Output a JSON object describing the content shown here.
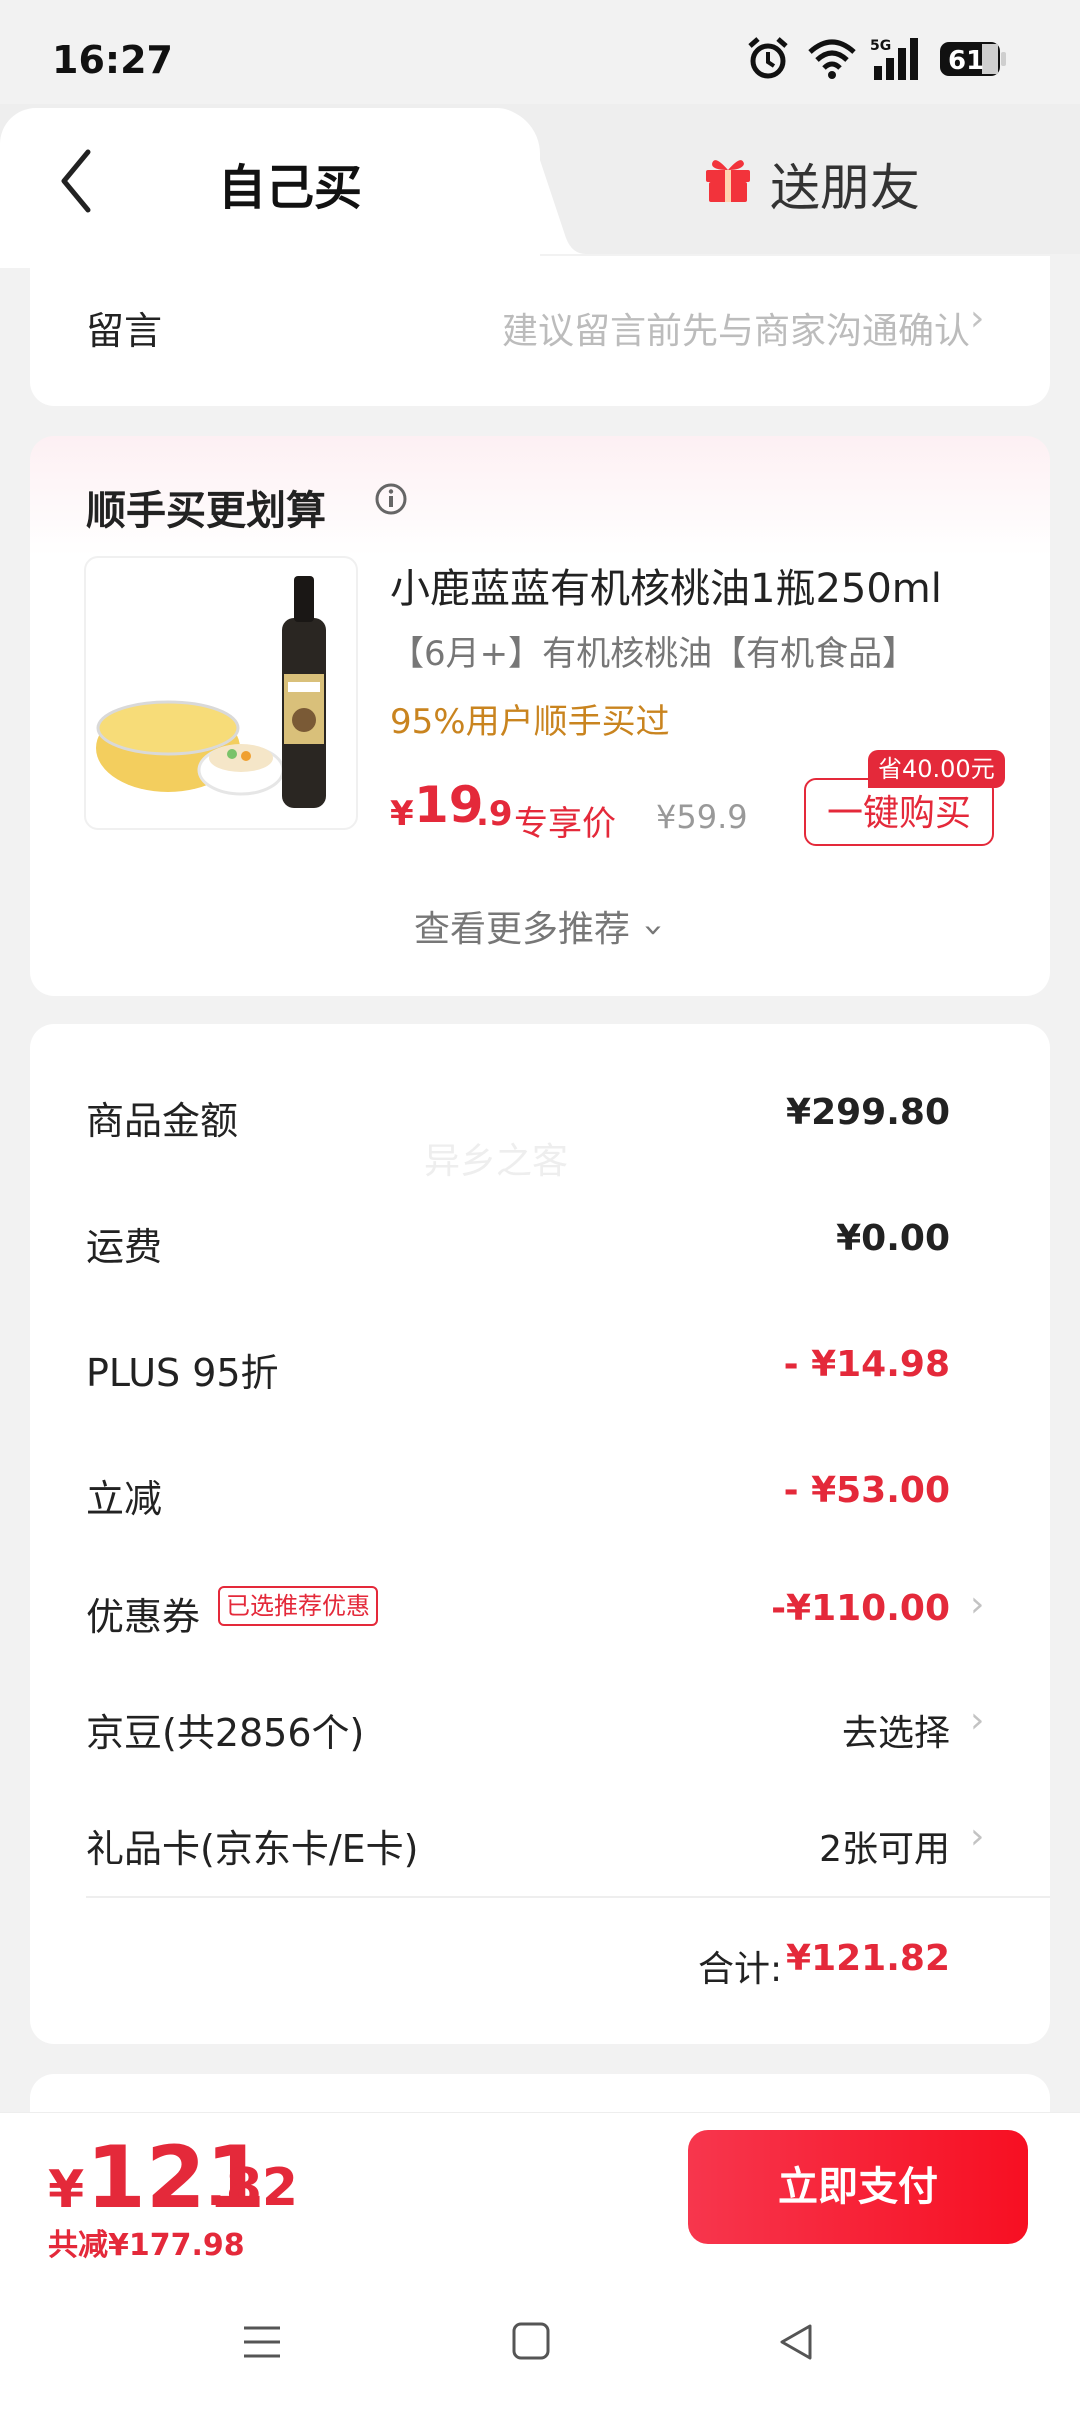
{
  "status_bar": {
    "time": "16:27",
    "battery": "61"
  },
  "tabs": {
    "self_label": "自己买",
    "friend_label": "送朋友"
  },
  "message": {
    "label": "留言",
    "hint": "建议留言前先与商家沟通确认"
  },
  "recommend": {
    "title": "顺手买更划算",
    "product": {
      "name": "小鹿蓝蓝有机核桃油1瓶250ml",
      "tags": "【6月+】有机核桃油【有机食品】",
      "social": "95%用户顺手买过",
      "price_currency": "¥",
      "price_int": "19",
      "price_dec": ".9",
      "price_tag": "专享价",
      "original_price": "¥59.9",
      "save_badge": "省40.00元",
      "buy_label": "一键购买"
    },
    "more_label": "查看更多推荐"
  },
  "summary": {
    "rows": [
      {
        "label": "商品金额",
        "value": "¥299.80"
      },
      {
        "label": "运费",
        "value": "¥0.00"
      },
      {
        "label": "PLUS 95折",
        "value": "- ¥14.98"
      },
      {
        "label": "立减",
        "value": "- ¥53.00"
      },
      {
        "label": "优惠券",
        "badge": "已选推荐优惠",
        "value": "-¥110.00"
      },
      {
        "label": "京豆(共2856个)",
        "value": "去选择"
      },
      {
        "label": "礼品卡(京东卡/E卡)",
        "value": "2张可用"
      }
    ],
    "total_label": "合计:",
    "total_value": "¥121.82"
  },
  "watermark": "异乡之客",
  "bottom_bar": {
    "currency": "¥",
    "amount_int": "121",
    "amount_dec": ".82",
    "saved": "共减¥177.98",
    "pay_label": "立即支付"
  },
  "colors": {
    "accent": "#e4293a",
    "pay_gradient_start": "#f7364d",
    "pay_gradient_end": "#f70f22",
    "social": "#c9841f"
  },
  "icons": [
    "back-arrow-icon",
    "gift-icon",
    "info-icon",
    "chevron-right-icon",
    "chevron-down-icon",
    "alarm-icon",
    "wifi-icon",
    "signal-icon",
    "battery-icon",
    "menu-nav-icon",
    "home-nav-icon",
    "back-nav-icon"
  ]
}
